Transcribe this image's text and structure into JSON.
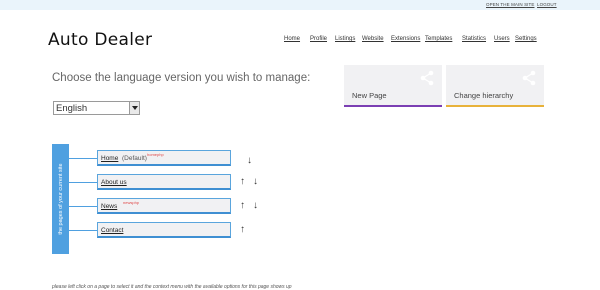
{
  "top_links": {
    "open_main_site": "OPEN THE MAIN SITE",
    "logout": "LOGOUT"
  },
  "logo": "Auto Dealer",
  "nav": [
    "Home",
    "Profile",
    "Listings",
    "Website",
    "Extensions",
    "Templates",
    "Statistics",
    "Users",
    "Settings"
  ],
  "heading": "Choose the language version you wish to manage:",
  "language_select": {
    "value": "English"
  },
  "tiles": [
    {
      "label": "New Page",
      "accent": "#7b3fb3",
      "icon": "share-icon"
    },
    {
      "label": "Change hierarchy",
      "accent": "#e8b23a",
      "icon": "share-icon"
    }
  ],
  "pages_sidebar_label": "the pages of your current site",
  "pages": [
    {
      "name": "Home",
      "default_label": "(Default)",
      "tag": "homephp",
      "arrows": [
        "down"
      ]
    },
    {
      "name": "About us",
      "default_label": "",
      "tag": "",
      "arrows": [
        "up",
        "down"
      ]
    },
    {
      "name": "News",
      "default_label": "",
      "tag": "newsphp",
      "arrows": [
        "up",
        "down"
      ]
    },
    {
      "name": "Contact",
      "default_label": "",
      "tag": "",
      "arrows": [
        "up"
      ]
    }
  ],
  "arrow_glyphs": {
    "up": "↑",
    "down": "↓"
  },
  "footnote": "please left click on a page to select it and the context menu with the available options for this page shows up",
  "colors": {
    "sidebar": "#4fa0e0",
    "node_border": "#3f8fd2",
    "tag": "#e04a4a"
  }
}
